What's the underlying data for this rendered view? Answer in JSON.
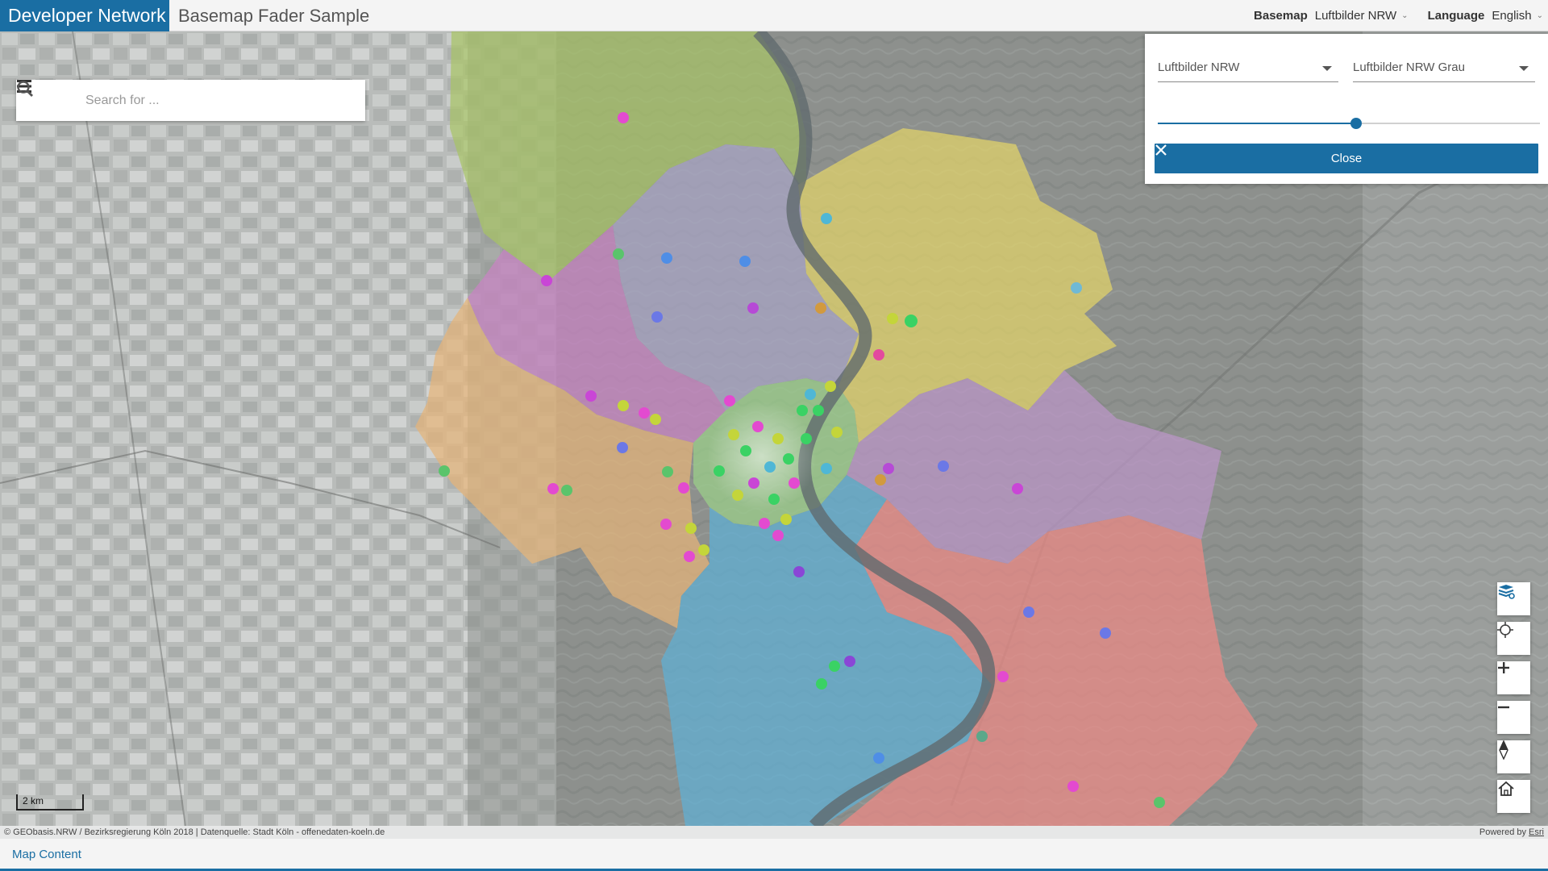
{
  "header": {
    "brand": "Developer Network",
    "title": "Basemap Fader Sample",
    "basemap_label": "Basemap",
    "basemap_value": "Luftbilder NRW",
    "language_label": "Language",
    "language_value": "English"
  },
  "search": {
    "placeholder": "Search for ..."
  },
  "fader": {
    "left_basemap": "Luftbilder NRW",
    "right_basemap": "Luftbilder NRW Grau",
    "slider_fraction": 0.52,
    "close_label": "Close"
  },
  "controls": [
    "basemap-toggle-icon",
    "locate-icon",
    "zoom-in-icon",
    "zoom-out-icon",
    "compass-icon",
    "home-icon"
  ],
  "scalebar": {
    "label": "2 km"
  },
  "attribution": {
    "source": "© GEObasis.NRW / Bezirksregierung Köln 2018 | Datenquelle: Stadt Köln - offenedaten-koeln.de",
    "powered_by": "Powered by",
    "powered_link": "Esri"
  },
  "footer": {
    "map_content": "Map Content"
  },
  "colors": {
    "accent": "#1a6ea3",
    "district_colors": [
      "#a8c466",
      "#c984c4",
      "#e6b57a",
      "#a9a6c6",
      "#e3d46a",
      "#bc96c8",
      "#5fb0d6",
      "#ee8a86",
      "#9bd08a"
    ]
  }
}
